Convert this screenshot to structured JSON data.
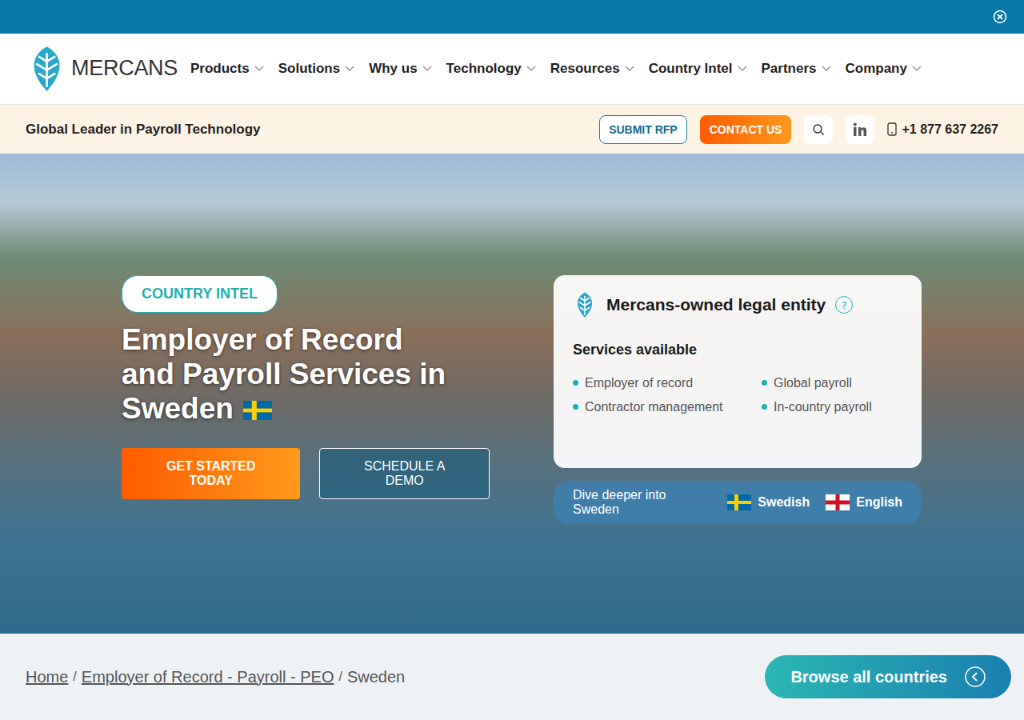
{
  "logo": {
    "text": "MERCANS"
  },
  "nav": [
    {
      "label": "Products"
    },
    {
      "label": "Solutions"
    },
    {
      "label": "Why us"
    },
    {
      "label": "Technology"
    },
    {
      "label": "Resources"
    },
    {
      "label": "Country Intel"
    },
    {
      "label": "Partners"
    },
    {
      "label": "Company"
    }
  ],
  "subbar": {
    "tagline": "Global Leader in Payroll Technology",
    "rfp_button": "SUBMIT RFP",
    "contact_button": "CONTACT US",
    "phone": "+1 877 637 2267"
  },
  "hero": {
    "badge": "COUNTRY INTEL",
    "title_lines": [
      "Employer of Record",
      "and Payroll Services in",
      "Sweden"
    ],
    "primary_button": "GET STARTED TODAY",
    "secondary_button": "SCHEDULE A DEMO"
  },
  "entity_card": {
    "title": "Mercans-owned legal entity",
    "help": "?",
    "services_heading": "Services available",
    "services": [
      "Employer of record",
      "Global payroll",
      "Contractor management",
      "In-country payroll"
    ]
  },
  "languages": {
    "label": "Dive deeper into Sweden",
    "options": [
      {
        "label": "Swedish",
        "kind": "sweden"
      },
      {
        "label": "English",
        "kind": "england"
      }
    ]
  },
  "breadcrumb": {
    "separator": "/",
    "items": [
      {
        "label": "Home",
        "link": true
      },
      {
        "label": "Employer of Record - Payroll - PEO",
        "link": true
      },
      {
        "label": "Sweden",
        "link": false
      }
    ]
  },
  "browse_button": "Browse all countries"
}
